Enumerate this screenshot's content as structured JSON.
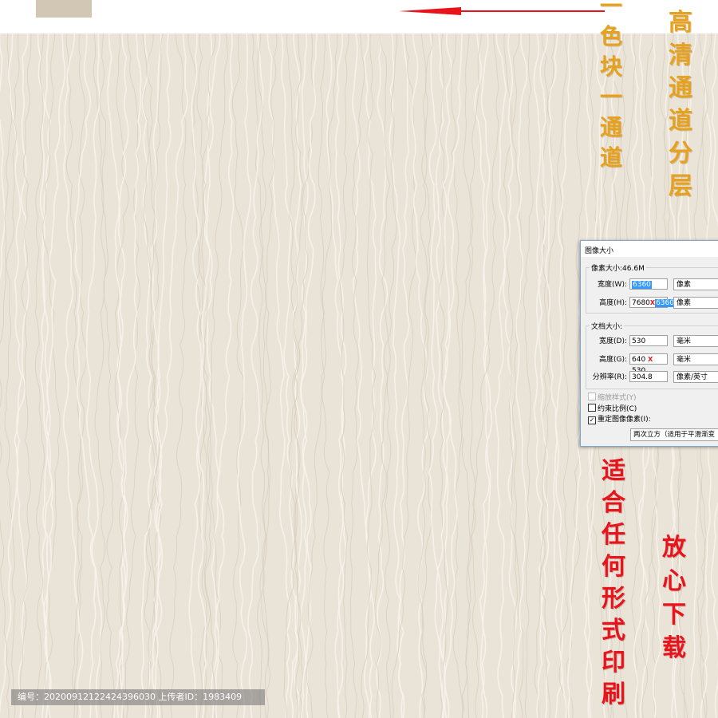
{
  "colors": {
    "swatch": "#d2c7b5",
    "texture": "#eae3d8",
    "gold": "#e6a21e",
    "red": "#e8141c",
    "arrow": "#e8141c"
  },
  "callouts": {
    "swatch_channel": [
      "一",
      "色",
      "块",
      "一",
      "通",
      "道"
    ],
    "hd_channel_layers": [
      "高",
      "清",
      "通",
      "道",
      "分",
      "层"
    ],
    "print_any": [
      "适",
      "合",
      "任",
      "何",
      "形",
      "式",
      "印",
      "刷"
    ],
    "download": [
      "放",
      "心",
      "下",
      "载"
    ]
  },
  "dialog": {
    "title": "图像大小",
    "pixel_size_label": "像素大小:46.6M",
    "width_label": "宽度(W):",
    "width_value": "6360",
    "width_unit": "像素",
    "height_label": "高度(H):",
    "height_old": "7680",
    "height_new": "6360",
    "height_unit": "像素",
    "doc_size_label": "文档大小:",
    "doc_width_label": "宽度(D):",
    "doc_width_value": "530",
    "doc_width_unit": "毫米",
    "doc_height_label": "高度(G):",
    "doc_height_old": "640",
    "doc_height_new": "530",
    "doc_height_unit": "毫米",
    "resolution_label": "分辨率(R):",
    "resolution_value": "304.8",
    "resolution_unit": "像素/英寸",
    "scale_styles": "缩放样式(Y)",
    "constrain": "约束比例(C)",
    "resample": "重定图像像素(I):",
    "resample_method": "两次立方（适用于平滑渐变",
    "x_mark": "X",
    "check_mark": "✓",
    "chevron": "⌄"
  },
  "footer": {
    "id_text": "编号：20200912122424396030 上传者ID：1983409"
  }
}
